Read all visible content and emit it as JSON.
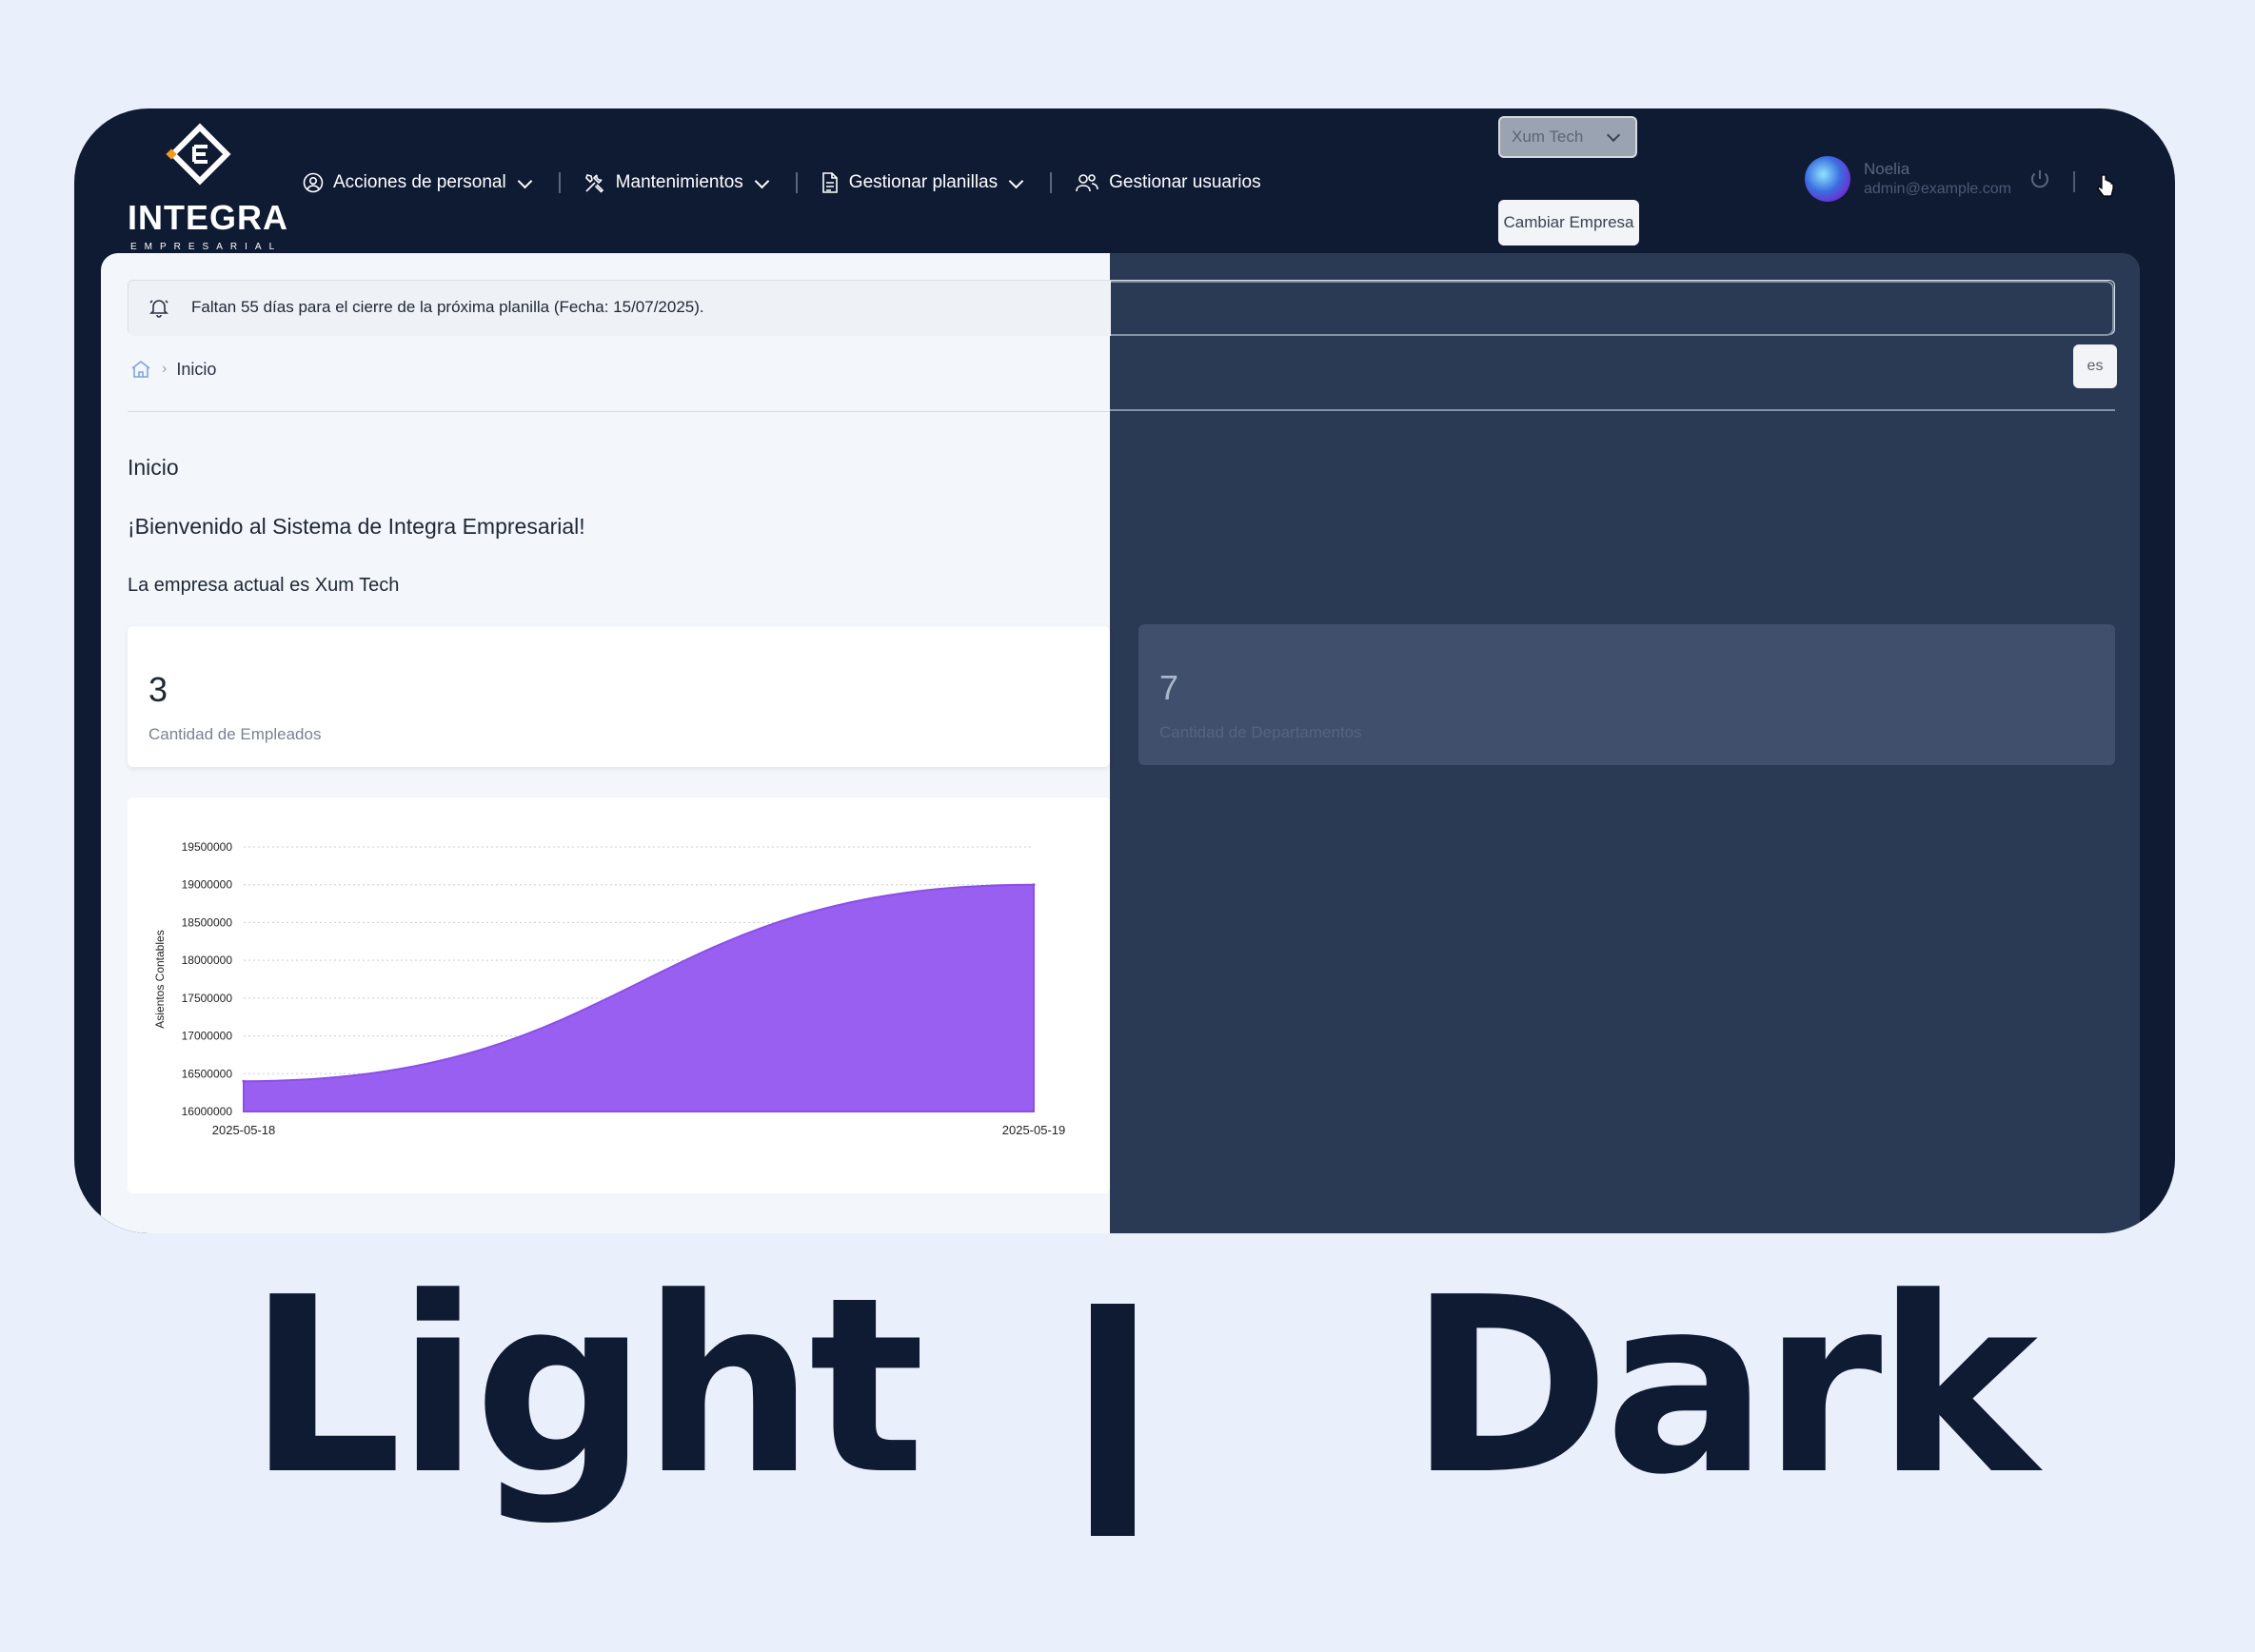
{
  "brand": {
    "name": "INTEGRA",
    "tagline": "EMPRESARIAL"
  },
  "nav": {
    "items": [
      {
        "label": "Acciones de personal",
        "icon": "user-circle-icon",
        "has_dropdown": true
      },
      {
        "label": "Mantenimientos",
        "icon": "tools-icon",
        "has_dropdown": true
      },
      {
        "label": "Gestionar planillas",
        "icon": "document-icon",
        "has_dropdown": true
      },
      {
        "label": "Gestionar usuarios",
        "icon": "users-icon",
        "has_dropdown": false
      }
    ]
  },
  "company_switch": {
    "selected": "Xum Tech",
    "button_label": "Cambiar Empresa"
  },
  "user": {
    "name": "Noelia",
    "email": "admin@example.com"
  },
  "notice": {
    "text": "Faltan 55 días para el cierre de la próxima planilla (Fecha: 15/07/2025)."
  },
  "breadcrumb": {
    "current": "Inicio"
  },
  "language": {
    "code": "es"
  },
  "page": {
    "title": "Inicio",
    "welcome": "¡Bienvenido al Sistema de Integra Empresarial!",
    "company_line": "La empresa actual es Xum Tech"
  },
  "stats": [
    {
      "value": "3",
      "label": "Cantidad de Empleados"
    },
    {
      "value": "7",
      "label": "Cantidad de Departamentos"
    }
  ],
  "chart_data": {
    "type": "area",
    "x": [
      "2025-05-18",
      "2025-05-19"
    ],
    "y": [
      16400000,
      19000000
    ],
    "ylabel": "Asientos Contables",
    "xlabel": "",
    "title": "",
    "ylim": [
      16000000,
      19500000
    ],
    "yticks": [
      "19500000",
      "19000000",
      "18500000",
      "18000000",
      "17500000",
      "17000000",
      "16500000",
      "16000000"
    ],
    "grid": true,
    "color": "#985ff0"
  },
  "caption": {
    "left": "Light",
    "separator": "|",
    "right": "Dark"
  },
  "colors": {
    "header": "#0f1a33",
    "light_bg": "#f3f7fc",
    "dark_bg": "#2a3a55",
    "accent": "#985ff0"
  }
}
